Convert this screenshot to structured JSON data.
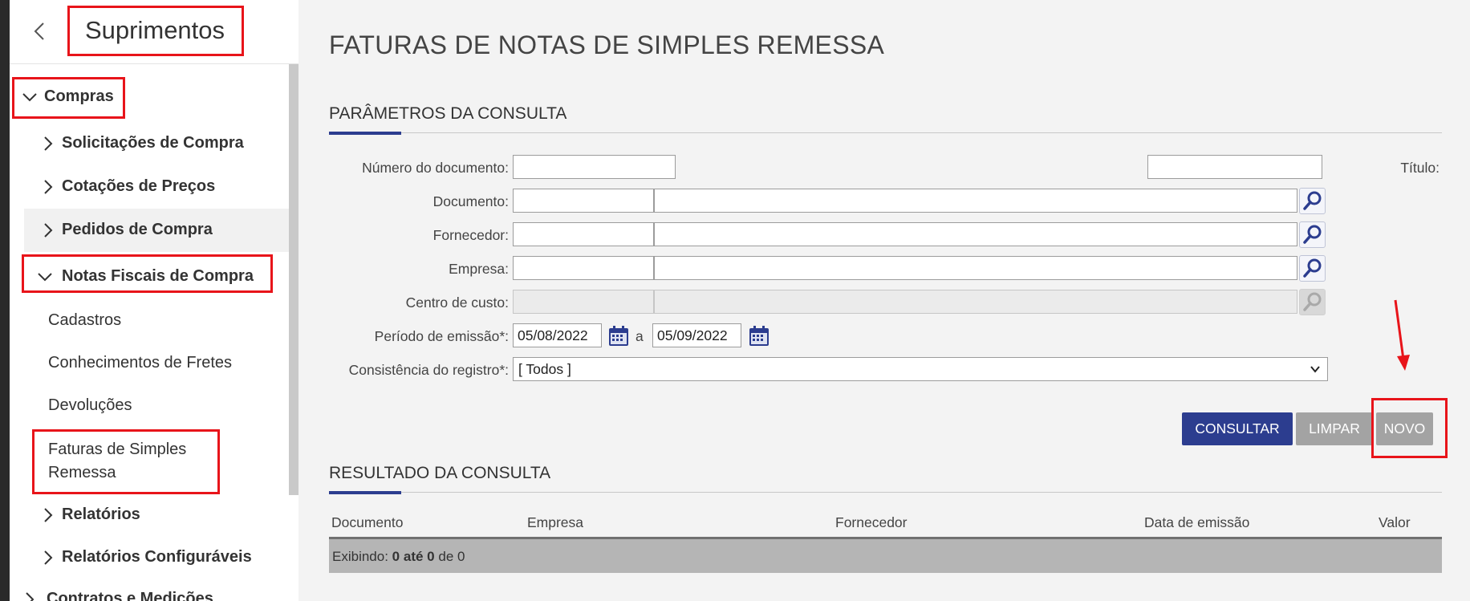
{
  "sidebar": {
    "title": "Suprimentos",
    "items": [
      {
        "label": "Compras"
      },
      {
        "label": "Solicitações de Compra"
      },
      {
        "label": "Cotações de Preços"
      },
      {
        "label": "Pedidos de Compra"
      },
      {
        "label": "Notas Fiscais de Compra"
      },
      {
        "label": "Cadastros"
      },
      {
        "label": "Conhecimentos de Fretes"
      },
      {
        "label": "Devoluções"
      },
      {
        "label": "Faturas de Simples Remessa"
      },
      {
        "label": "Relatórios"
      },
      {
        "label": "Relatórios Configuráveis"
      },
      {
        "label": "Contratos e Medições"
      }
    ]
  },
  "page": {
    "title": "FATURAS DE NOTAS DE SIMPLES REMESSA"
  },
  "params": {
    "section_title": "PARÂMETROS DA CONSULTA",
    "numero_label": "Número do documento:",
    "numero_value": "",
    "titulo_label": "Título:",
    "titulo_value": "",
    "documento_label": "Documento:",
    "fornecedor_label": "Fornecedor:",
    "empresa_label": "Empresa:",
    "centro_label": "Centro de custo:",
    "periodo_label": "Período de emissão*:",
    "periodo_from": "05/08/2022",
    "periodo_sep": "a",
    "periodo_to": "05/09/2022",
    "consistencia_label": "Consistência do registro*:",
    "consistencia_value": "[ Todos ]"
  },
  "buttons": {
    "consultar": "CONSULTAR",
    "limpar": "LIMPAR",
    "novo": "NOVO"
  },
  "results": {
    "section_title": "RESULTADO DA CONSULTA",
    "columns": [
      "Documento",
      "Empresa",
      "Fornecedor",
      "Data de emissão",
      "Valor"
    ],
    "footer_prefix": "Exibindo: ",
    "footer_from": "0",
    "footer_ate": " até ",
    "footer_to": "0",
    "footer_suffix": " de 0"
  },
  "colors": {
    "accent": "#2c3d8f",
    "annotation": "#e8141a",
    "button_disabled": "#a3a3a3"
  },
  "icons": {
    "back": "chevron-left-icon",
    "expanded": "chevron-down-icon",
    "collapsed": "chevron-right-icon",
    "lookup": "magnifier-icon",
    "calendar": "calendar-icon"
  }
}
